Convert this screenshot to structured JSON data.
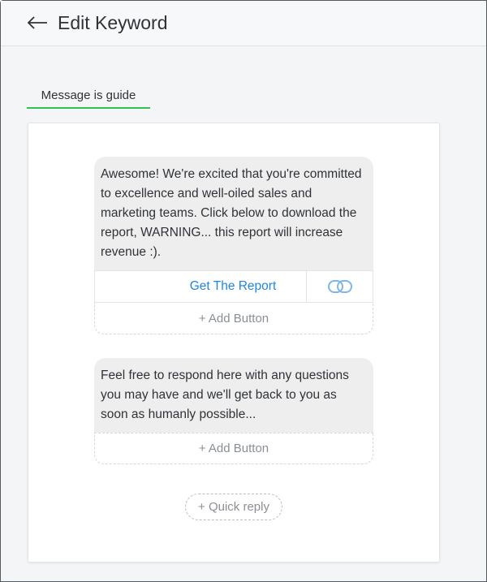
{
  "header": {
    "title": "Edit Keyword",
    "back_icon": "arrow-left-icon"
  },
  "tabs": [
    {
      "label": "Message is guide",
      "active": true,
      "accent": "#2fc05a"
    }
  ],
  "messages": [
    {
      "text": "Awesome! We're excited that you're committed to excellence and well-oiled sales and marketing teams. Click below to download the report, WARNING... this report will increase revenue :).",
      "buttons": [
        {
          "label": "Get The Report",
          "icon": "link-icon",
          "color": "#1f86e0"
        }
      ],
      "add_button_label": "+ Add Button"
    },
    {
      "text": "Feel free to respond here with any questions you may have and we'll get back to you as soon as humanly possible...",
      "buttons": [],
      "add_button_label": "+ Add Button"
    }
  ],
  "quick_reply_label": "+ Quick reply"
}
